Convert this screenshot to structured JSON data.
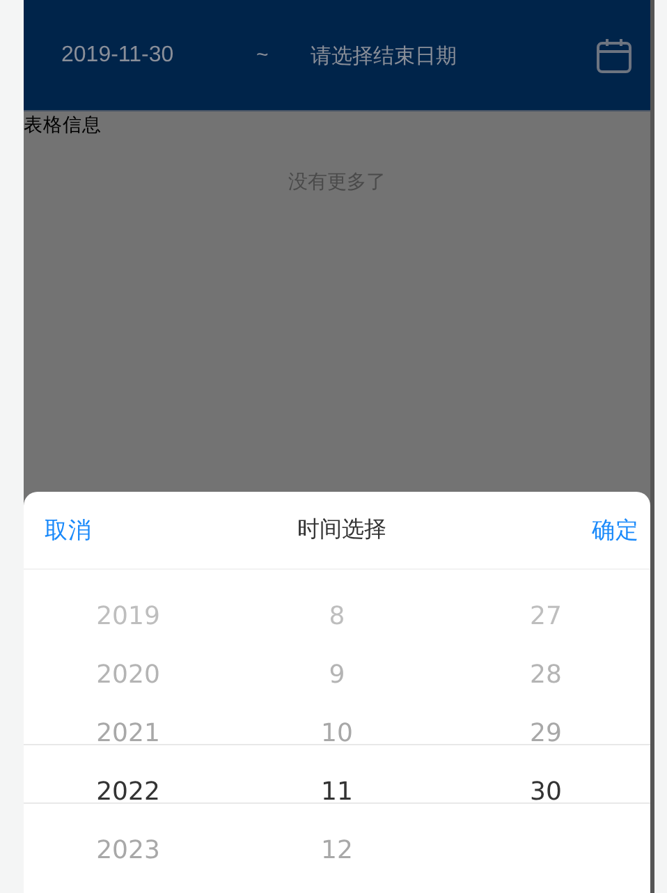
{
  "header": {
    "start_date": "2019-11-30",
    "separator": "~",
    "end_date_placeholder": "请选择结束日期"
  },
  "section_title": "表格信息",
  "list_end": "没有更多了",
  "picker": {
    "cancel": "取消",
    "title": "时间选择",
    "confirm": "确定",
    "columns": [
      {
        "items": [
          {
            "label": "2019",
            "selected": false
          },
          {
            "label": "2020",
            "selected": false
          },
          {
            "label": "2021",
            "selected": false
          },
          {
            "label": "2022",
            "selected": true
          },
          {
            "label": "2023",
            "selected": false
          }
        ]
      },
      {
        "items": [
          {
            "label": "8",
            "selected": false
          },
          {
            "label": "9",
            "selected": false
          },
          {
            "label": "10",
            "selected": false
          },
          {
            "label": "11",
            "selected": true
          },
          {
            "label": "12",
            "selected": false
          }
        ]
      },
      {
        "items": [
          {
            "label": "27",
            "selected": false
          },
          {
            "label": "28",
            "selected": false
          },
          {
            "label": "29",
            "selected": false
          },
          {
            "label": "30",
            "selected": true
          }
        ]
      }
    ]
  }
}
